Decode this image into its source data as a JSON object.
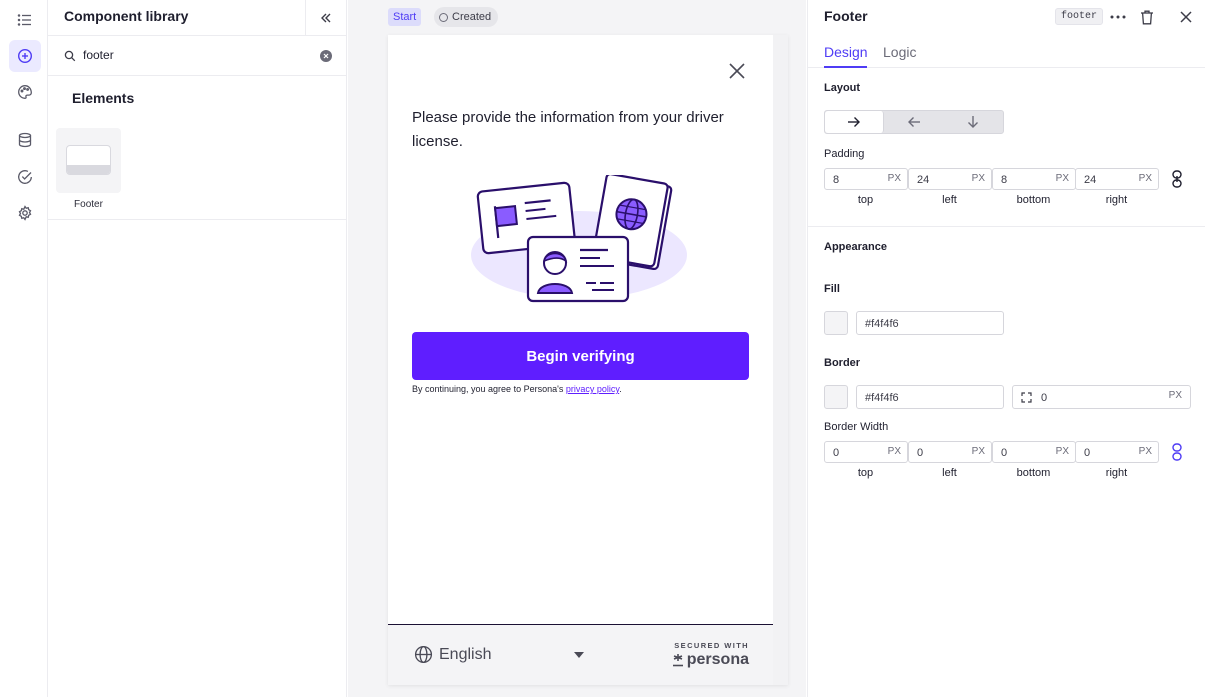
{
  "rail": {
    "icons": [
      "list-icon",
      "add-circle-icon",
      "palette-icon",
      "database-icon",
      "check-circle-icon",
      "gear-icon"
    ]
  },
  "library": {
    "title": "Component library",
    "search_value": "footer",
    "section_title": "Elements",
    "items": [
      {
        "label": "Footer"
      }
    ]
  },
  "canvas": {
    "start_badge": "Start",
    "created_badge": "Created",
    "screen": {
      "prompt": "Please provide the information from your driver license.",
      "cta_label": "Begin verifying",
      "legal_prefix": "By continuing, you agree to Persona's ",
      "legal_link": "privacy policy",
      "legal_suffix": ".",
      "language": "English",
      "secured_caption": "SECURED WITH",
      "brand": "persona"
    }
  },
  "properties": {
    "title": "Footer",
    "tag": "footer",
    "tabs": [
      {
        "label": "Design"
      },
      {
        "label": "Logic"
      }
    ],
    "layout_label": "Layout",
    "padding_label": "Padding",
    "padding": [
      {
        "value": "8",
        "unit": "PX",
        "side": "top"
      },
      {
        "value": "24",
        "unit": "PX",
        "side": "left"
      },
      {
        "value": "8",
        "unit": "PX",
        "side": "bottom"
      },
      {
        "value": "24",
        "unit": "PX",
        "side": "right"
      }
    ],
    "appearance_label": "Appearance",
    "fill_label": "Fill",
    "fill_value": "#f4f4f6",
    "border_label": "Border",
    "border_value": "#f4f4f6",
    "border_radius_value": "0",
    "border_radius_unit": "PX",
    "border_width_label": "Border Width",
    "border_width": [
      {
        "value": "0",
        "unit": "PX",
        "side": "top"
      },
      {
        "value": "0",
        "unit": "PX",
        "side": "left"
      },
      {
        "value": "0",
        "unit": "PX",
        "side": "bottom"
      },
      {
        "value": "0",
        "unit": "PX",
        "side": "right"
      }
    ]
  },
  "colors": {
    "accent": "#4f3cf5",
    "cta": "#5f1eff",
    "canvas_bg": "#f4f4f6"
  }
}
